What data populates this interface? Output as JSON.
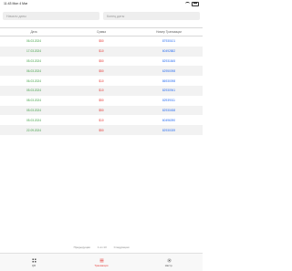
{
  "status_bar": {
    "time": "11:43   Mon 4 Mar"
  },
  "filters": {
    "start_placeholder": "Начало даты",
    "end_placeholder": "Конец даты"
  },
  "table": {
    "headers": [
      "Дата",
      "Сумма",
      "Номер Транзакции"
    ],
    "rows": [
      [
        "06.03.2024",
        "$50",
        "87930101"
      ],
      [
        "17.03.2024",
        "$10",
        "60492882"
      ],
      [
        "05.03.2024",
        "$50",
        "82931845"
      ],
      [
        "06.03.2024",
        "$50",
        "62950098"
      ],
      [
        "06.03.2024",
        "$10",
        "86930098"
      ],
      [
        "05.03.2024",
        "$10",
        "82930941"
      ],
      [
        "08.03.2024",
        "$50",
        "82939011"
      ],
      [
        "05.03.2024",
        "$50",
        "82930458"
      ],
      [
        "05.03.2024",
        "$10",
        "60496090"
      ],
      [
        "22.09.2024",
        "$50",
        "82930039"
      ]
    ]
  },
  "pagination": {
    "prev": "Предыдущая",
    "page": "1 из 13",
    "next": "Следующая"
  },
  "tabbar": {
    "items": [
      {
        "label": "QR",
        "icon": "grid-icon",
        "active": false
      },
      {
        "label": "Транзакции",
        "icon": "list-icon",
        "active": true
      },
      {
        "label": "Настр.",
        "icon": "gear-icon",
        "active": false
      }
    ]
  },
  "colors": {
    "date": "#43a047",
    "amount": "#e53935",
    "number": "#2b6ef0",
    "accent": "#e53935"
  }
}
